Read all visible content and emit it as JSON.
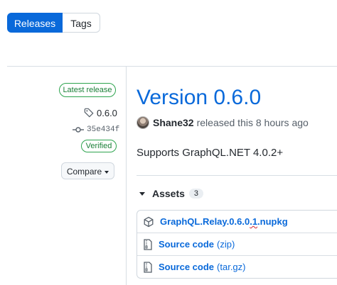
{
  "tabs": {
    "releases": "Releases",
    "tags": "Tags"
  },
  "sidebar": {
    "latest_badge": "Latest release",
    "tag": "0.6.0",
    "commit": "35e434f",
    "verified": "Verified",
    "compare": "Compare"
  },
  "release": {
    "title": "Version 0.6.0",
    "author": "Shane32",
    "meta": "released this 8 hours ago",
    "description": "Supports GraphQL.NET 4.0.2+"
  },
  "assets": {
    "label": "Assets",
    "count": "3",
    "items": [
      {
        "name_main": "GraphQL.Relay.0.6.0",
        "name_squiggle": ".1",
        "name_tail": ".nupkg",
        "suffix": "",
        "icon": "package-icon"
      },
      {
        "name": "Source code",
        "suffix": "(zip)",
        "icon": "file-zip-icon"
      },
      {
        "name": "Source code",
        "suffix": "(tar.gz)",
        "icon": "file-zip-icon"
      }
    ]
  },
  "colors": {
    "accent": "#0969da",
    "success": "#1a7f37",
    "border": "#d0d7de"
  }
}
